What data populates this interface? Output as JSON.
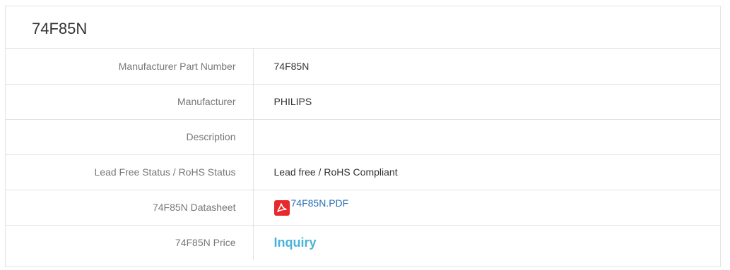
{
  "title": "74F85N",
  "rows": [
    {
      "label": "Manufacturer Part Number",
      "value": "74F85N"
    },
    {
      "label": "Manufacturer",
      "value": "PHILIPS"
    },
    {
      "label": "Description",
      "value": ""
    },
    {
      "label": "Lead Free Status / RoHS Status",
      "value": "Lead free / RoHS Compliant"
    },
    {
      "label": "74F85N Datasheet",
      "link_text": "74F85N.PDF",
      "icon": "pdf-icon"
    },
    {
      "label": "74F85N Price",
      "link_text": "Inquiry"
    }
  ],
  "colors": {
    "link": "#2a6fb8",
    "inquiry": "#4ab3d8",
    "pdf_icon": "#e8282b",
    "border": "#e3e3e3"
  }
}
